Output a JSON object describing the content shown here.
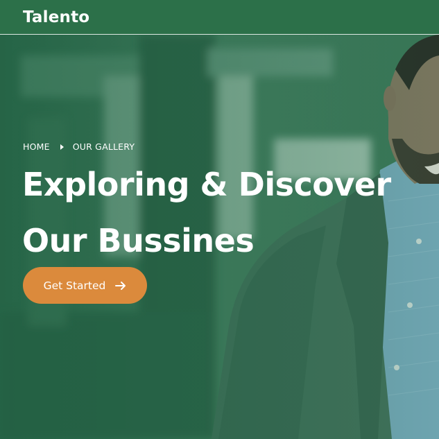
{
  "navbar": {
    "logo": "Talento"
  },
  "hero": {
    "breadcrumb": {
      "home": "HOME",
      "current": "OUR GALLERY"
    },
    "title_line1": "Exploring & Discover",
    "title_line2": "Our Bussines",
    "cta_label": "Get Started",
    "cta_icon": "arrow-right-icon"
  },
  "colors": {
    "navbar_bg": "#2c7049",
    "hero_overlay": "#2d6e4e",
    "cta_bg": "#db8a3c",
    "text": "#ffffff"
  }
}
